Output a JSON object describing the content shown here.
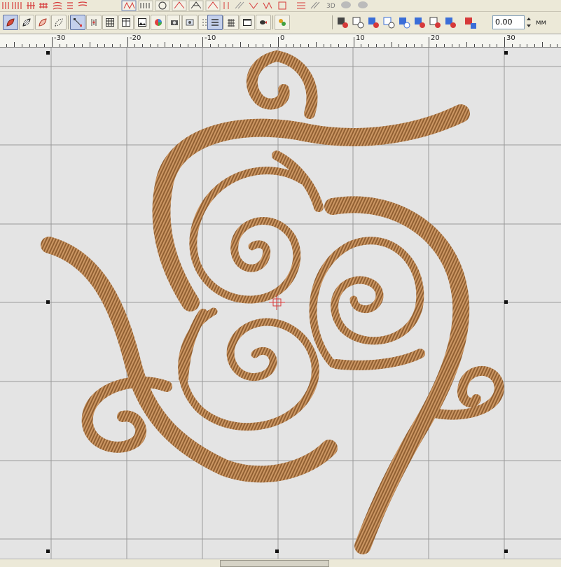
{
  "toolbar": {
    "row1_buttons": [
      "fill-stitch",
      "satin-stitch",
      "running-stitch",
      "cross-stitch",
      "grid-fill",
      "motif-fill",
      "radial-fill",
      "contour-fill",
      "spiral-fill",
      "column-a",
      "column-b",
      "zigzag",
      "layer-a",
      "layer-b",
      "3d-view",
      "3d-label",
      "stitch-preview-a",
      "stitch-preview-b"
    ],
    "row1_label_3d": "3D",
    "row2_buttons": [
      "fill-shape",
      "pattern-fill",
      "outline-shape",
      "marquee-select",
      "reshape-node",
      "knife",
      "grid-a",
      "grid-b",
      "picture",
      "color-wheel",
      "camera",
      "toggle-a",
      "toggle-b",
      "toggle-c",
      "screen",
      "stitch-player",
      "route-a",
      "route-b",
      "node-a",
      "node-b",
      "node-c",
      "node-d",
      "node-e",
      "node-f",
      "node-g",
      "node-h",
      "node-i",
      "node-j"
    ],
    "offset_value": "0.00",
    "offset_unit": "мм"
  },
  "ruler": {
    "labels": [
      "-30",
      "-20",
      "-10",
      "0",
      "10",
      "20",
      "30"
    ]
  },
  "canvas": {
    "design_color": "#b8834f",
    "grid_color": "#9a9a9a",
    "stitch_highlight_color": "#e040f0",
    "cursor_icon": "crosshair-icon"
  }
}
